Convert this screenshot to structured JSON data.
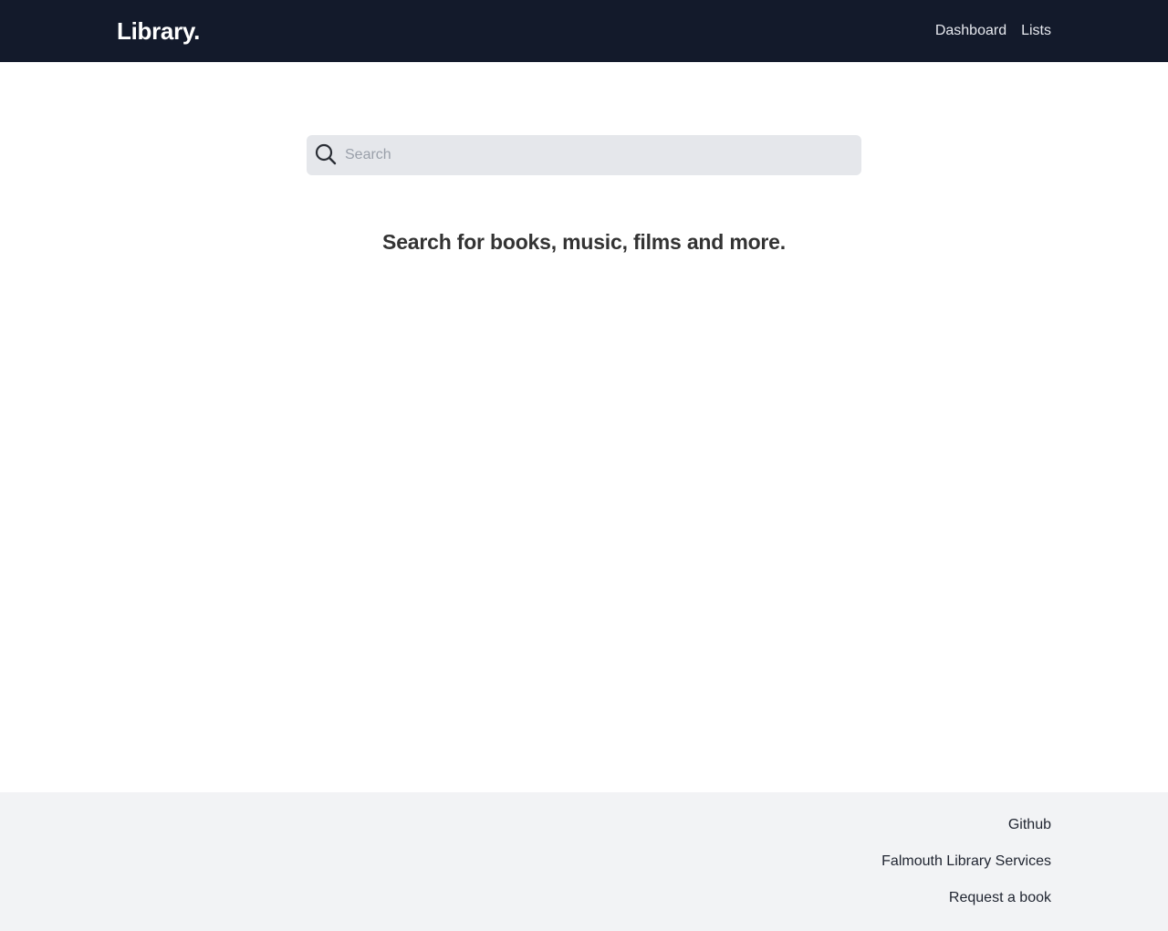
{
  "header": {
    "brand": "Library.",
    "nav": [
      {
        "label": "Dashboard"
      },
      {
        "label": "Lists"
      }
    ]
  },
  "search": {
    "placeholder": "Search",
    "value": "",
    "icon": "search-icon"
  },
  "main": {
    "prompt": "Search for books, music, films and more."
  },
  "footer": {
    "links": [
      {
        "label": "Github"
      },
      {
        "label": "Falmouth Library Services"
      },
      {
        "label": "Request a book"
      }
    ]
  },
  "colors": {
    "header_bg": "#131a2b",
    "search_bg": "#e5e7eb",
    "footer_bg": "#f2f3f5",
    "prompt_text": "#333333"
  }
}
